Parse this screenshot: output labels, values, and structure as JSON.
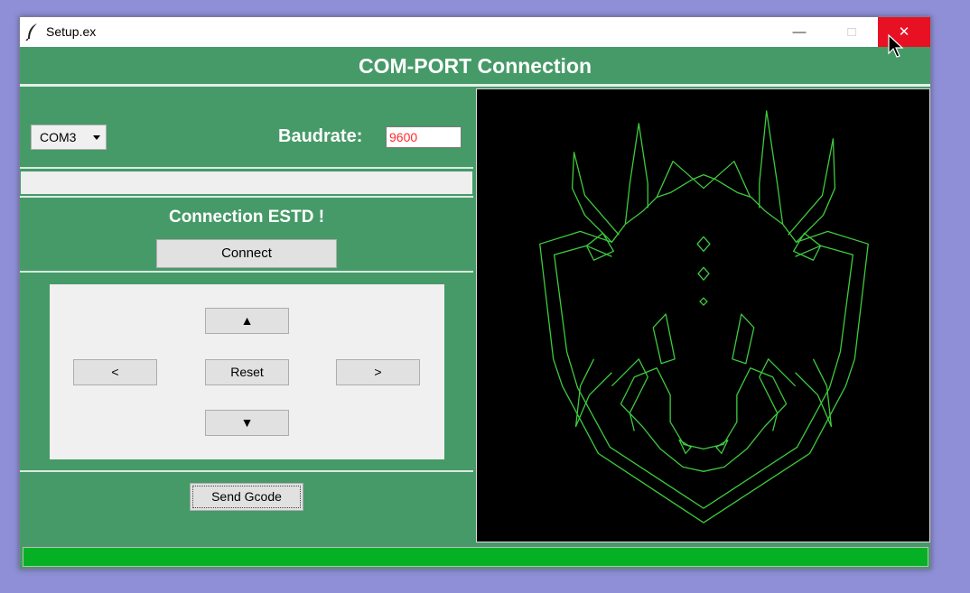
{
  "window": {
    "title": "Setup.ex",
    "controls": {
      "minimize": "—",
      "maximize": "□",
      "close": "✕"
    }
  },
  "header": {
    "title": "COM-PORT Connection"
  },
  "port": {
    "selected": "COM3"
  },
  "baud": {
    "label": "Baudrate:",
    "value": "9600"
  },
  "connection": {
    "status": "Connection ESTD !",
    "connect_label": "Connect"
  },
  "jog": {
    "up": "▲",
    "left": "<",
    "reset": "Reset",
    "right": ">",
    "down": "▼"
  },
  "send": {
    "label": "Send Gcode"
  },
  "progress": {
    "percent": 100
  },
  "colors": {
    "panel": "#469a68",
    "drawing": "#3ecb3e",
    "progress": "#06b025",
    "close": "#e81123"
  },
  "icons": [
    "feather-icon",
    "cursor-icon",
    "dropdown-arrow-icon"
  ]
}
